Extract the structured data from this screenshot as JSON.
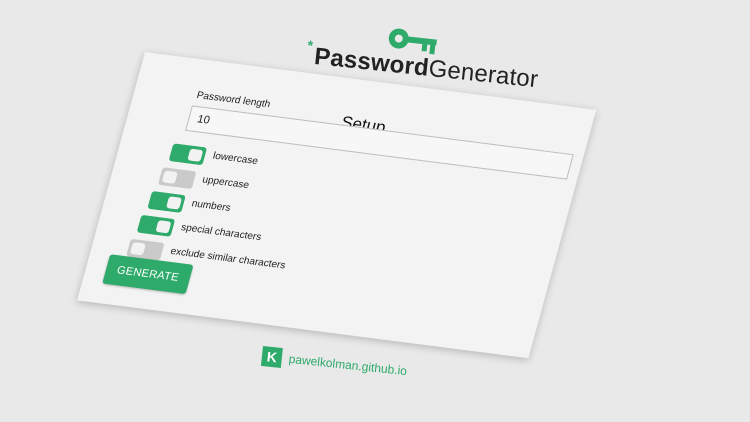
{
  "logo": {
    "star": "*",
    "word_bold": "Password",
    "word_thin": "Generator",
    "icon": "key-icon",
    "accent_color": "#2eaa6a"
  },
  "setup": {
    "title": "Setup",
    "length_label": "Password length",
    "length_value": "10"
  },
  "options": [
    {
      "label": "lowercase",
      "enabled": true
    },
    {
      "label": "uppercase",
      "enabled": false
    },
    {
      "label": "numbers",
      "enabled": true
    },
    {
      "label": "special characters",
      "enabled": true
    },
    {
      "label": "exclude similar characters",
      "enabled": false
    }
  ],
  "generate_label": "GENERATE",
  "footer": {
    "icon": "k-logo-icon",
    "icon_glyph": "K",
    "link_text": "pawelkolman.github.io"
  }
}
